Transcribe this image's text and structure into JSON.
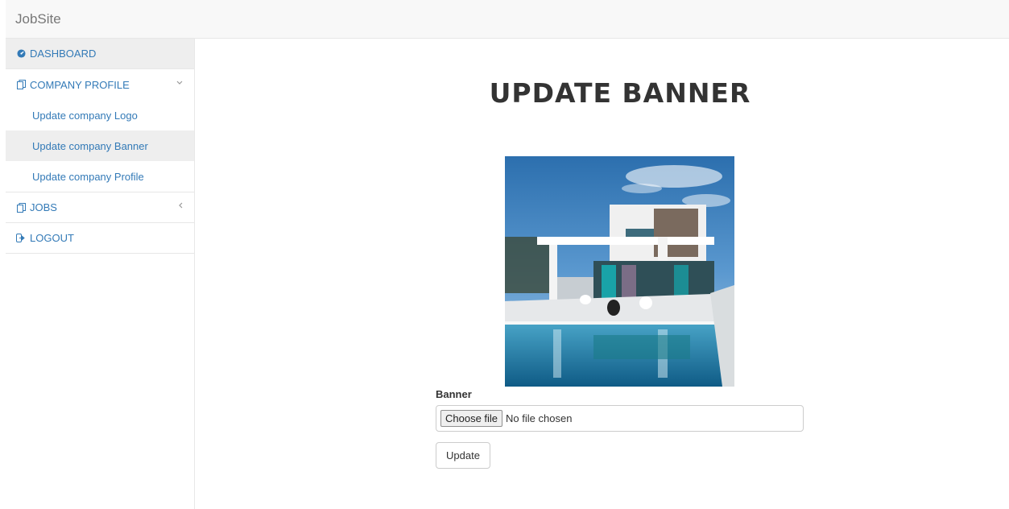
{
  "app": {
    "brand": "JobSite"
  },
  "sidebar": {
    "dashboard": {
      "label": "DASHBOARD",
      "icon": "dashboard-icon"
    },
    "company_profile": {
      "label": "COMPANY PROFILE",
      "icon": "copy-icon",
      "expanded": true,
      "children": [
        {
          "label": "Update company Logo"
        },
        {
          "label": "Update company Banner",
          "active": true
        },
        {
          "label": "Update company Profile"
        }
      ]
    },
    "jobs": {
      "label": "JOBS",
      "icon": "copy-icon"
    },
    "logout": {
      "label": "LOGOUT",
      "icon": "sign-out-icon"
    }
  },
  "main": {
    "title": "UPDATE BANNER",
    "banner_label": "Banner",
    "file_button": "Choose file",
    "file_status": "No file chosen",
    "submit_label": "Update"
  },
  "colors": {
    "link": "#337ab7",
    "active_bg": "#eeeeee",
    "navbar_bg": "#f8f8f8"
  }
}
